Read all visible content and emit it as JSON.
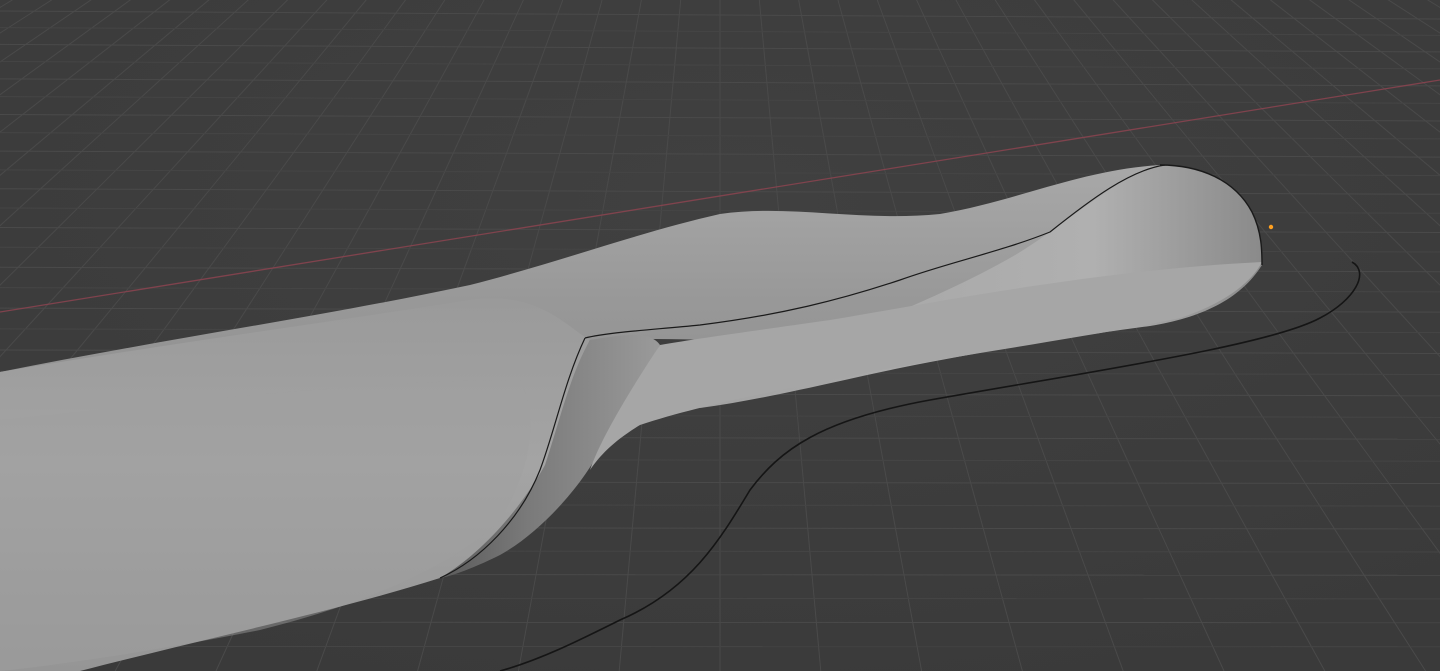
{
  "viewport": {
    "view": "perspective",
    "shading": "solid",
    "background_color": "#3d3d3d",
    "grid": {
      "visible": true,
      "line_color": "#4a4a4a",
      "subdivision_color": "#454545"
    },
    "axis_x_color": "#8c4450",
    "mesh_color": "#9c9c9c",
    "outline_color": "#1a1a1a",
    "object_origin_color": "#ffa020",
    "origin_marker": "orange-dot-icon"
  }
}
